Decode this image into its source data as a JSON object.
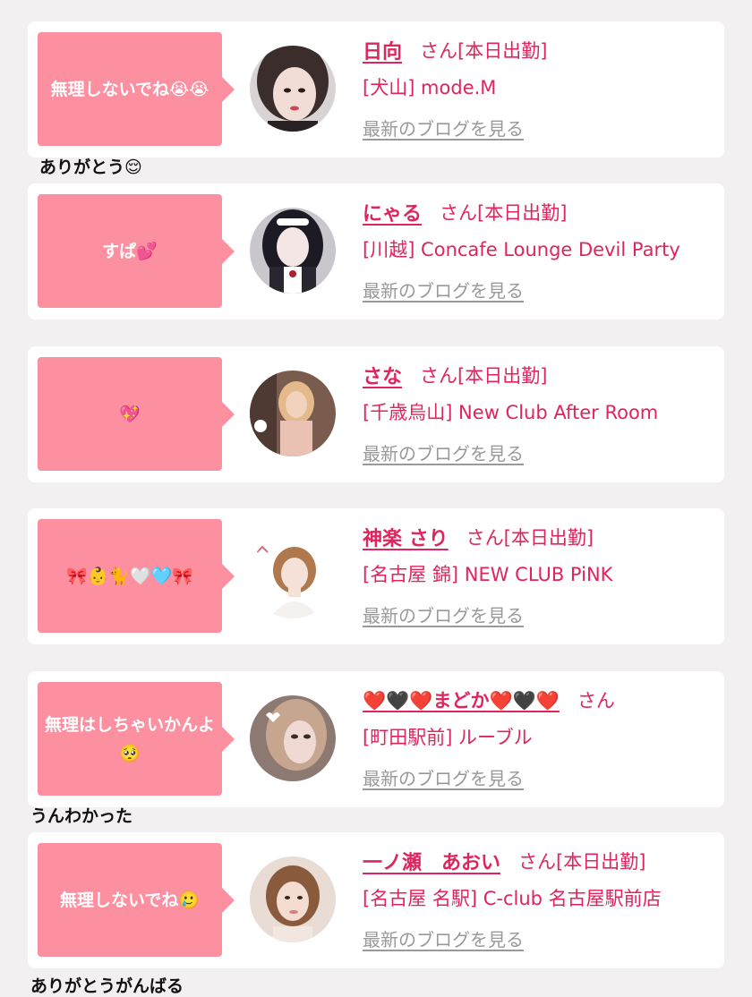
{
  "blog_link_label": "最新のブログを見る",
  "san_label": "さん",
  "cards": [
    {
      "message": "無理しないでね😭😭",
      "name": "日向",
      "status": "[本日出勤]",
      "shop": "[犬山] mode.M",
      "reply": "ありがとう😌"
    },
    {
      "message": "すぱ💕",
      "name": "にゃる",
      "status": "[本日出勤]",
      "shop": "[川越] Concafe Lounge Devil Party",
      "reply": ""
    },
    {
      "message": "💖",
      "name": "さな",
      "status": "[本日出勤]",
      "shop": "[千歳烏山] New Club After Room",
      "reply": ""
    },
    {
      "message": "🎀👶🐈🤍🩵🎀",
      "name": "神楽 さり",
      "status": "[本日出勤]",
      "shop": "[名古屋 錦] NEW CLUB PiNK",
      "reply": ""
    },
    {
      "message": "無理はしちゃいかんよ🥺",
      "name": "❤️🖤❤️まどか❤️🖤❤️",
      "status": "",
      "shop": "[町田駅前] ルーブル",
      "reply": "うんわかった"
    },
    {
      "message": "無理しないでね🥲",
      "name": "一ノ瀬　あおい",
      "status": "[本日出勤]",
      "shop": "[名古屋 名駅] C-club 名古屋駅前店",
      "reply": "ありがとうがんばる"
    }
  ],
  "colors": {
    "bubble": "#fc8fa0",
    "accent": "#e0245e",
    "link_gray": "#999999",
    "background": "#f2f0f1"
  }
}
